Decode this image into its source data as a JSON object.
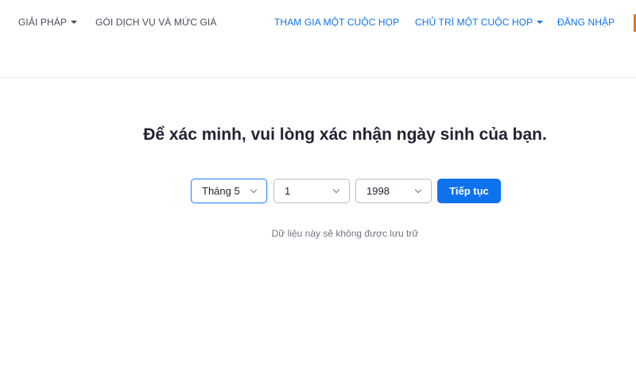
{
  "nav": {
    "left": [
      {
        "label": "GIẢI PHÁP",
        "has_dropdown": true
      },
      {
        "label": "GÓI DỊCH VỤ VÀ MỨC GIÁ",
        "has_dropdown": false
      }
    ],
    "right": [
      {
        "label": "THAM GIA MỘT CUỘC HỌP",
        "has_dropdown": false
      },
      {
        "label": "CHỦ TRÌ MỘT CUỘC HỌP",
        "has_dropdown": true
      },
      {
        "label": "ĐĂNG NHẬP",
        "has_dropdown": false
      }
    ]
  },
  "verification": {
    "heading": "Để xác minh, vui lòng xác nhận ngày sinh của bạn.",
    "month_value": "Tháng 5",
    "day_value": "1",
    "year_value": "1998",
    "continue_label": "Tiếp tục",
    "note": "Dữ liệu này sẽ không được lưu trữ"
  },
  "colors": {
    "accent": "#0e72ed",
    "nav_left_text": "#4a4a5a",
    "heading_text": "#232333",
    "note_text": "#6e7680",
    "edge_accent": "#e8731a"
  },
  "icons": {
    "dropdown": "caret-down-icon",
    "select": "chevron-down-icon"
  }
}
